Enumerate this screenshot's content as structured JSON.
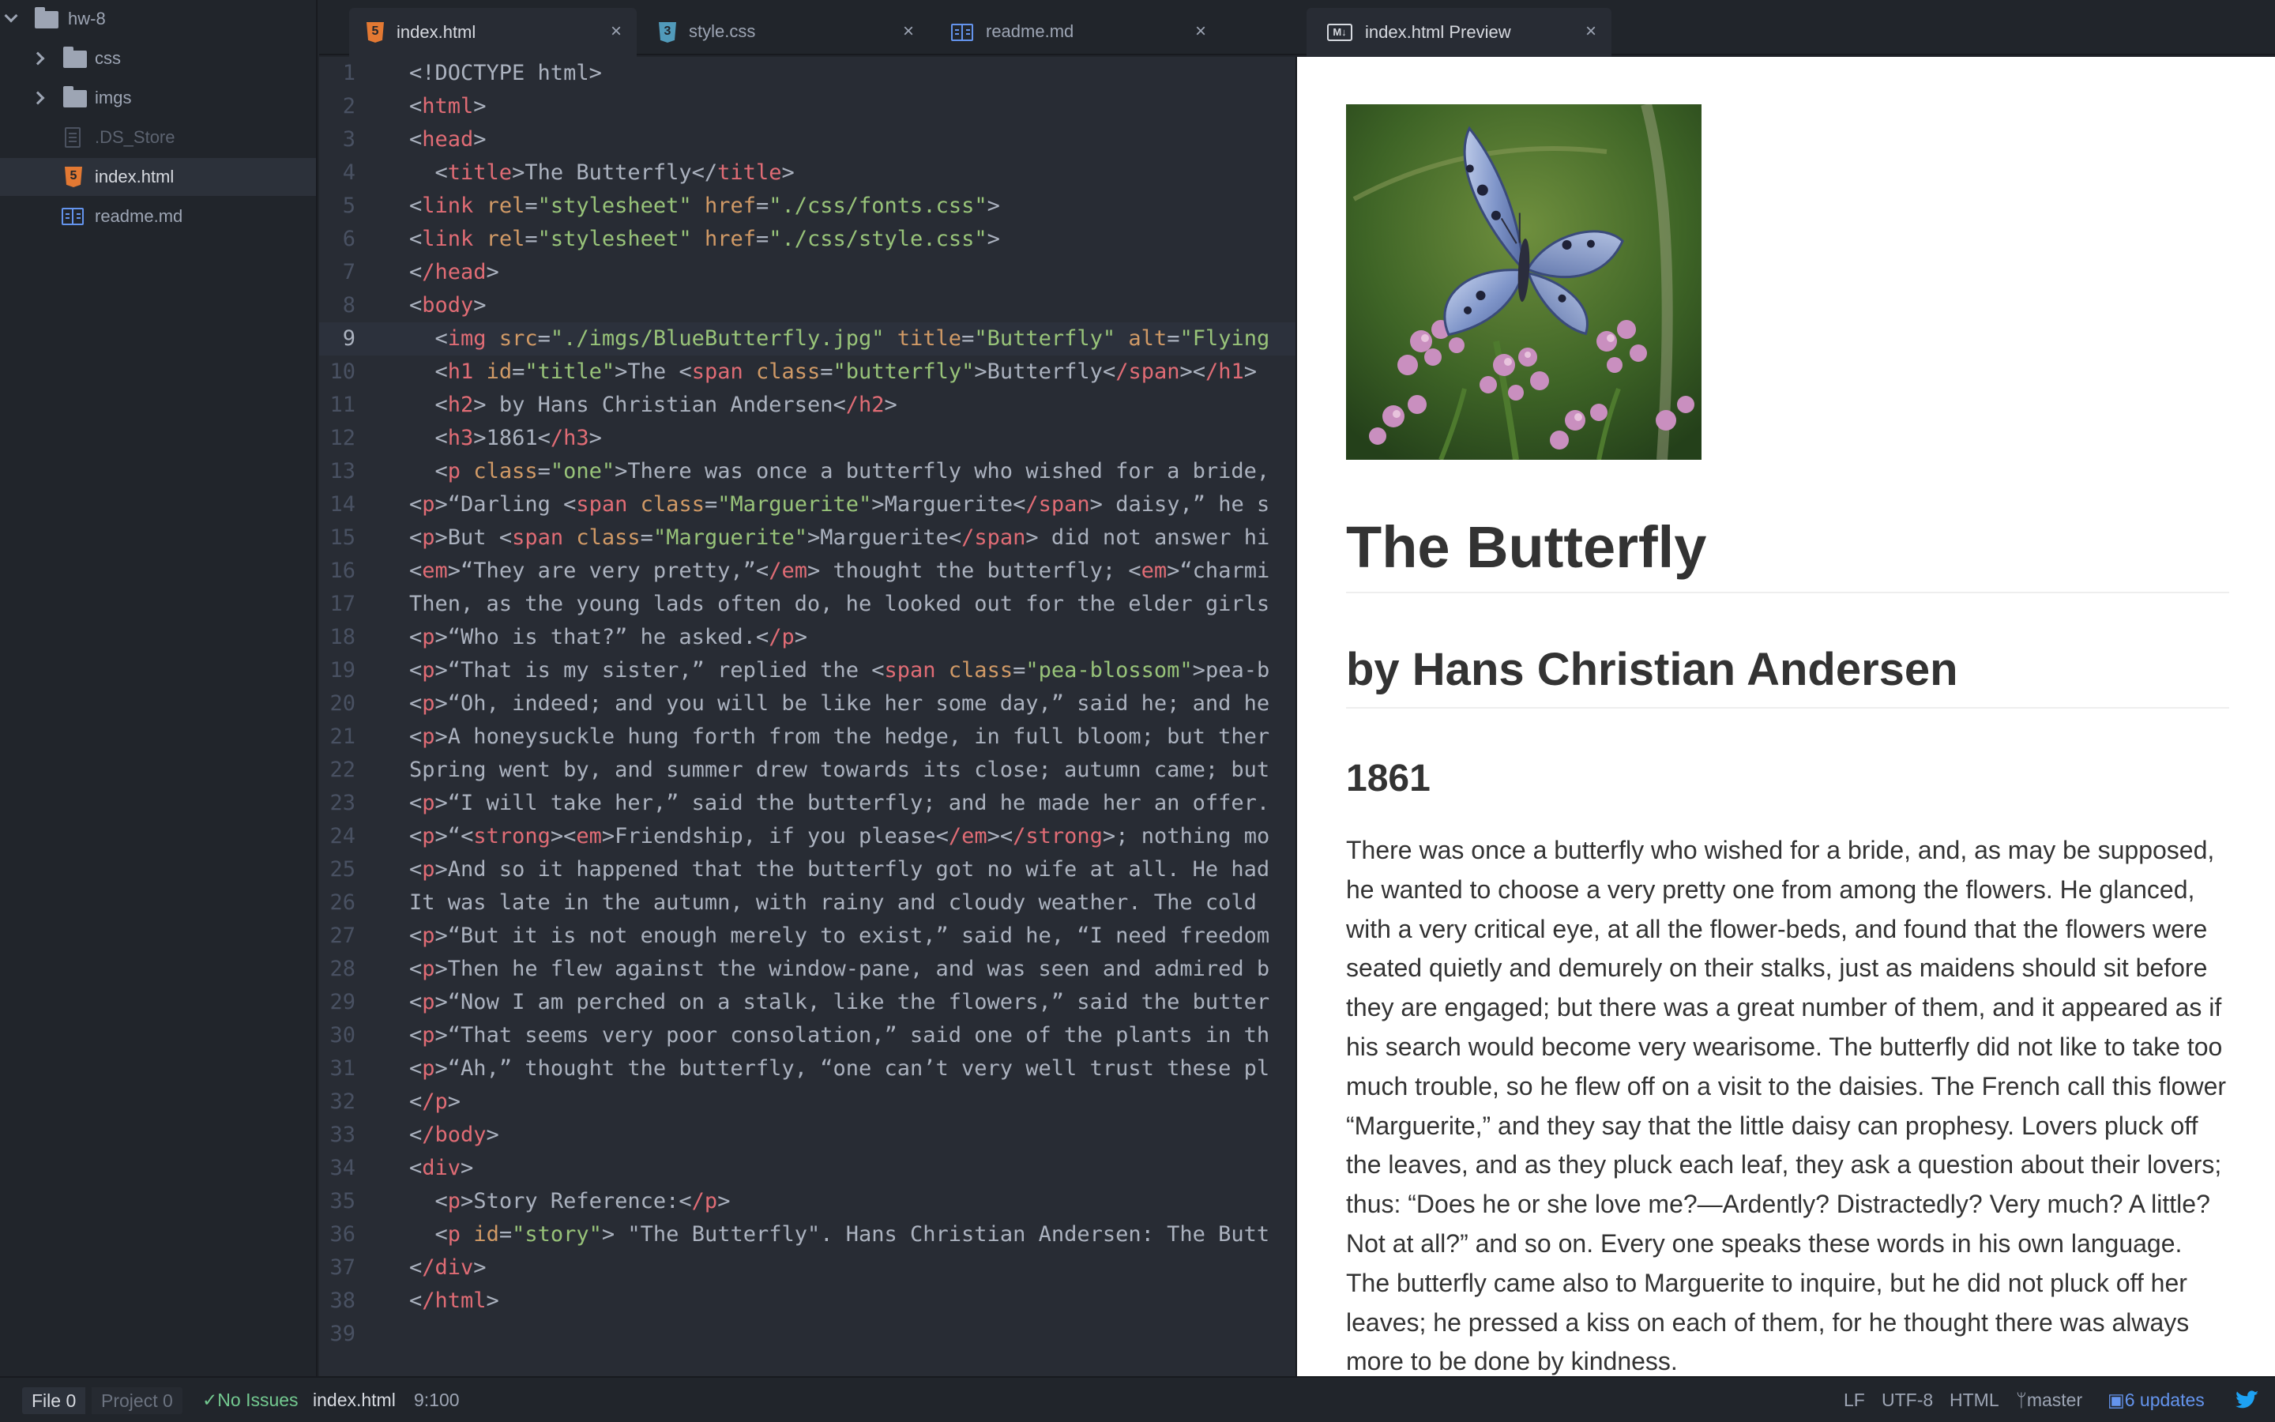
{
  "tree": {
    "project": "hw-8",
    "items": [
      {
        "label": "css",
        "type": "folder"
      },
      {
        "label": "imgs",
        "type": "folder"
      },
      {
        "label": ".DS_Store",
        "type": "file"
      },
      {
        "label": "index.html",
        "type": "html"
      },
      {
        "label": "readme.md",
        "type": "markdown"
      }
    ]
  },
  "tabs": [
    {
      "label": "index.html",
      "active": true
    },
    {
      "label": "style.css"
    },
    {
      "label": "readme.md"
    }
  ],
  "preview_tab": {
    "label": "index.html Preview",
    "icon": "markdown-icon"
  },
  "editor": {
    "cursor_line": 9,
    "lines": [
      {
        "n": "1"
      },
      {
        "n": "2"
      },
      {
        "n": "3"
      },
      {
        "n": "4"
      },
      {
        "n": "5"
      },
      {
        "n": "6"
      },
      {
        "n": "7"
      },
      {
        "n": "8"
      },
      {
        "n": "9"
      },
      {
        "n": "10"
      },
      {
        "n": "11"
      },
      {
        "n": "12"
      },
      {
        "n": "13"
      },
      {
        "n": "14"
      },
      {
        "n": "15"
      },
      {
        "n": "16"
      },
      {
        "n": "17"
      },
      {
        "n": "18"
      },
      {
        "n": "19"
      },
      {
        "n": "20"
      },
      {
        "n": "21"
      },
      {
        "n": "22"
      },
      {
        "n": "23"
      },
      {
        "n": "24"
      },
      {
        "n": "25"
      },
      {
        "n": "26"
      },
      {
        "n": "27"
      },
      {
        "n": "28"
      },
      {
        "n": "29"
      },
      {
        "n": "30"
      },
      {
        "n": "31"
      },
      {
        "n": "32"
      },
      {
        "n": "33"
      },
      {
        "n": "34"
      },
      {
        "n": "35"
      },
      {
        "n": "36"
      },
      {
        "n": "37"
      },
      {
        "n": "38"
      },
      {
        "n": "39"
      }
    ],
    "code": {
      "l1": "<!DOCTYPE html>",
      "l2_tag": "html",
      "l3_tag": "head",
      "l4_tag": "title",
      "l4_text": "The Butterfly",
      "l5_tag": "link",
      "l5_a1": "rel",
      "l5_v1": "\"stylesheet\"",
      "l5_a2": "href",
      "l5_v2": "\"./css/fonts.css\"",
      "l6_tag": "link",
      "l6_a1": "rel",
      "l6_v1": "\"stylesheet\"",
      "l6_a2": "href",
      "l6_v2": "\"./css/style.css\"",
      "l7_tag": "/head",
      "l8_tag": "body",
      "l9_tag": "img",
      "l9_a1": "src",
      "l9_v1": "\"./imgs/BlueButterfly.jpg\"",
      "l9_a2": "title",
      "l9_v2": "\"Butterfly\"",
      "l9_a3": "alt",
      "l9_v3": "\"Flying",
      "l10_tag": "h1",
      "l10_a1": "id",
      "l10_v1": "\"title\"",
      "l10_text1": "The ",
      "l10_tag2": "span",
      "l10_a2": "class",
      "l10_v2": "\"butterfly\"",
      "l10_text2": "Butterfly",
      "l10_close1": "/span",
      "l10_close2": "/h1",
      "l11_tag": "h2",
      "l11_text": " by Hans Christian Andersen",
      "l11_close": "/h2",
      "l12_tag": "h3",
      "l12_text": "1861",
      "l12_close": "/h3",
      "l13_tag": "p",
      "l13_a1": "class",
      "l13_v1": "\"one\"",
      "l13_text": "There was once a butterfly who wished for a bride,",
      "l14_tag": "p",
      "l14_text1": "“Darling ",
      "l14_tag2": "span",
      "l14_a1": "class",
      "l14_v1": "\"Marguerite\"",
      "l14_text2": "Marguerite",
      "l14_close": "/span",
      "l14_text3": " daisy,” he s",
      "l15_tag": "p",
      "l15_text1": "But ",
      "l15_tag2": "span",
      "l15_a1": "class",
      "l15_v1": "\"Marguerite\"",
      "l15_text2": "Marguerite",
      "l15_close": "/span",
      "l15_text3": " did not answer hi",
      "l16_tag": "em",
      "l16_text1": "“They are very pretty,”",
      "l16_close": "/em",
      "l16_text2": " thought the butterfly; ",
      "l16_tag2": "em",
      "l16_text3": "“charmi",
      "l17_text": "Then, as the young lads often do, he looked out for the elder girls",
      "l18_tag": "p",
      "l18_text": "“Who is that?” he asked.",
      "l18_close": "/p",
      "l19_tag": "p",
      "l19_text1": "“That is my sister,” replied the ",
      "l19_tag2": "span",
      "l19_a1": "class",
      "l19_v1": "\"pea-blossom\"",
      "l19_text2": "pea-b",
      "l20_tag": "p",
      "l20_text": "“Oh, indeed; and you will be like her some day,” said he; and he",
      "l21_tag": "p",
      "l21_text": "A honeysuckle hung forth from the hedge, in full bloom; but ther",
      "l22_text": "Spring went by, and summer drew towards its close; autumn came; but",
      "l23_tag": "p",
      "l23_text": "“I will take her,” said the butterfly; and he made her an offer.",
      "l24_tag": "p",
      "l24_text1": "“",
      "l24_tag2": "strong",
      "l24_tag3": "em",
      "l24_text2": "Friendship, if you please",
      "l24_close1": "/em",
      "l24_close2": "/strong",
      "l24_text3": "; nothing mo",
      "l25_tag": "p",
      "l25_text": "And so it happened that the butterfly got no wife at all. He had",
      "l26_text": "It was late in the autumn, with rainy and cloudy weather. The cold",
      "l27_tag": "p",
      "l27_text": "“But it is not enough merely to exist,” said he, “I need freedom",
      "l28_tag": "p",
      "l28_text": "Then he flew against the window-pane, and was seen and admired b",
      "l29_tag": "p",
      "l29_text": "“Now I am perched on a stalk, like the flowers,” said the butter",
      "l30_tag": "p",
      "l30_text": "“That seems very poor consolation,” said one of the plants in th",
      "l31_tag": "p",
      "l31_text": "“Ah,” thought the butterfly, “one can’t very well trust these pl",
      "l32_tag": "/p",
      "l33_tag": "/body",
      "l34_tag": "div",
      "l35_tag": "p",
      "l35_text": "Story Reference:",
      "l35_close": "/p",
      "l36_tag": "p",
      "l36_a1": "id",
      "l36_v1": "\"story\"",
      "l36_text": " \"The Butterfly\". Hans Christian Andersen: The Butt",
      "l37_tag": "/div",
      "l38_tag": "/html"
    }
  },
  "preview": {
    "image_alt": "Blue butterfly on pink flowers",
    "h1": "The Butterfly",
    "h2": "by Hans Christian Andersen",
    "h3": "1861",
    "paragraph": "There was once a butterfly who wished for a bride, and, as may be supposed, he wanted to choose a very pretty one from among the flowers. He glanced, with a very critical eye, at all the flower-beds, and found that the flowers were seated quietly and demurely on their stalks, just as maidens should sit before they are engaged; but there was a great number of them, and it appeared as if his search would become very wearisome. The butterfly did not like to take too much trouble, so he flew off on a visit to the daisies. The French call this flower “Marguerite,” and they say that the little daisy can prophesy. Lovers pluck off the leaves, and as they pluck each leaf, they ask a question about their lovers; thus: “Does he or she love me?—Ardently? Distractedly? Very much? A little? Not at all?” and so on. Every one speaks these words in his own language. The butterfly came also to Marguerite to inquire, but he did not pluck off her leaves; he pressed a kiss on each of them, for he thought there was always more to be done by kindness."
  },
  "status": {
    "file_label": "File",
    "file_count": "0",
    "project_label": "Project",
    "project_count": "0",
    "issues": "No Issues",
    "filename": "index.html",
    "position": "9:100",
    "line_ending": "LF",
    "encoding": "UTF-8",
    "grammar": "HTML",
    "branch": "master",
    "updates": "6 updates"
  },
  "colors": {
    "tag": "#e06c75",
    "attr": "#d19a66",
    "string": "#98c379",
    "text": "#abb2bf",
    "accent": "#6494ed"
  }
}
